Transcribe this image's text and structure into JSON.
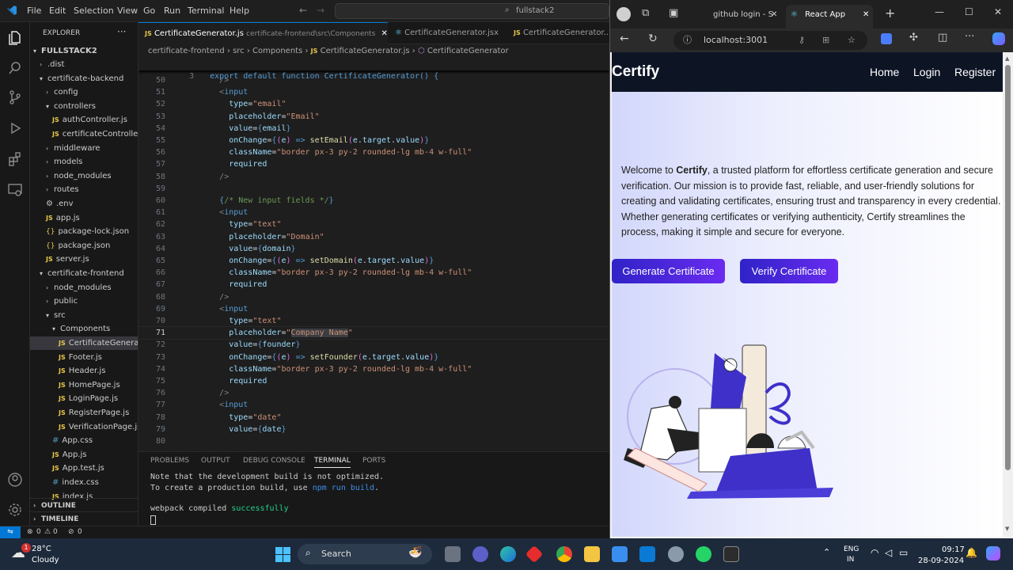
{
  "vscode": {
    "menu": [
      "File",
      "Edit",
      "Selection",
      "View",
      "Go",
      "Run",
      "Terminal",
      "Help"
    ],
    "search": "fullstack2",
    "explorer_title": "EXPLORER",
    "root": "FULLSTACK2",
    "tree": [
      {
        "label": ".dist",
        "type": "folder",
        "indent": 1,
        "open": false
      },
      {
        "label": "certificate-backend",
        "type": "folder",
        "indent": 1,
        "open": true
      },
      {
        "label": "config",
        "type": "folder",
        "indent": 2,
        "open": false
      },
      {
        "label": "controllers",
        "type": "folder",
        "indent": 2,
        "open": true
      },
      {
        "label": "authController.js",
        "type": "js",
        "indent": 3
      },
      {
        "label": "certificateControlle...",
        "type": "js",
        "indent": 3
      },
      {
        "label": "middleware",
        "type": "folder",
        "indent": 2,
        "open": false
      },
      {
        "label": "models",
        "type": "folder",
        "indent": 2,
        "open": false
      },
      {
        "label": "node_modules",
        "type": "folder",
        "indent": 2,
        "open": false
      },
      {
        "label": "routes",
        "type": "folder",
        "indent": 2,
        "open": false
      },
      {
        "label": ".env",
        "type": "env",
        "indent": 2
      },
      {
        "label": "app.js",
        "type": "js",
        "indent": 2
      },
      {
        "label": "package-lock.json",
        "type": "json",
        "indent": 2
      },
      {
        "label": "package.json",
        "type": "json",
        "indent": 2
      },
      {
        "label": "server.js",
        "type": "js",
        "indent": 2
      },
      {
        "label": "certificate-frontend",
        "type": "folder",
        "indent": 1,
        "open": true
      },
      {
        "label": "node_modules",
        "type": "folder",
        "indent": 2,
        "open": false
      },
      {
        "label": "public",
        "type": "folder",
        "indent": 2,
        "open": false
      },
      {
        "label": "src",
        "type": "folder",
        "indent": 2,
        "open": true
      },
      {
        "label": "Components",
        "type": "folder",
        "indent": 3,
        "open": true
      },
      {
        "label": "CertificateGenera...",
        "type": "js",
        "indent": 4,
        "selected": true
      },
      {
        "label": "Footer.js",
        "type": "js",
        "indent": 4
      },
      {
        "label": "Header.js",
        "type": "js",
        "indent": 4
      },
      {
        "label": "HomePage.js",
        "type": "js",
        "indent": 4
      },
      {
        "label": "LoginPage.js",
        "type": "js",
        "indent": 4
      },
      {
        "label": "RegisterPage.js",
        "type": "js",
        "indent": 4
      },
      {
        "label": "VerificationPage.js",
        "type": "js",
        "indent": 4
      },
      {
        "label": "App.css",
        "type": "css",
        "indent": 3
      },
      {
        "label": "App.js",
        "type": "js",
        "indent": 3
      },
      {
        "label": "App.test.js",
        "type": "js",
        "indent": 3
      },
      {
        "label": "index.css",
        "type": "css",
        "indent": 3
      },
      {
        "label": "index.js",
        "type": "js",
        "indent": 3
      }
    ],
    "outline": "OUTLINE",
    "timeline": "TIMELINE",
    "tabs": [
      {
        "label": "CertificateGenerator.js",
        "path": "certificate-frontend\\src\\Components",
        "active": true
      },
      {
        "label": "CertificateGenerator.jsx",
        "path": "",
        "active": false
      },
      {
        "label": "CertificateGenerator...",
        "path": "",
        "active": false
      }
    ],
    "breadcrumb": [
      "certificate-frontend",
      "src",
      "Components",
      "CertificateGenerator.js",
      "CertificateGenerator"
    ],
    "sticky_line": {
      "num": "3",
      "text": "export default function CertificateGenerator() {"
    },
    "code": [
      {
        "n": "50",
        "html": "        <span class='t-tag'>/></span>"
      },
      {
        "n": "51",
        "html": "        <span class='t-tag'>&lt;</span><span class='t-kw'>input</span>"
      },
      {
        "n": "52",
        "html": "          <span class='t-at'>type</span><span class='t-tx'>=</span><span class='t-st'>\"email\"</span>"
      },
      {
        "n": "53",
        "html": "          <span class='t-at'>placeholder</span><span class='t-tx'>=</span><span class='t-st'>\"Email\"</span>"
      },
      {
        "n": "54",
        "html": "          <span class='t-at'>value</span><span class='t-tx'>=</span><span class='t-kw'>{</span><span class='t-at'>email</span><span class='t-kw'>}</span>"
      },
      {
        "n": "55",
        "html": "          <span class='t-at'>onChange</span><span class='t-tx'>=</span><span class='t-kw'>{</span><span class='t-br'>(</span><span class='t-at'>e</span><span class='t-br'>)</span> <span class='t-kw'>=></span> <span class='t-fn'>setEmail</span><span class='t-br'>(</span><span class='t-at'>e</span>.<span class='t-at'>target</span>.<span class='t-at'>value</span><span class='t-br'>)</span><span class='t-kw'>}</span>"
      },
      {
        "n": "56",
        "html": "          <span class='t-at'>className</span><span class='t-tx'>=</span><span class='t-st'>\"border px-3 py-2 rounded-lg mb-4 w-full\"</span>"
      },
      {
        "n": "57",
        "html": "          <span class='t-at'>required</span>"
      },
      {
        "n": "58",
        "html": "        <span class='t-tag'>/></span>"
      },
      {
        "n": "59",
        "html": ""
      },
      {
        "n": "60",
        "html": "        <span class='t-kw'>{</span><span class='t-cm'>/* New input fields */</span><span class='t-kw'>}</span>"
      },
      {
        "n": "61",
        "html": "        <span class='t-tag'>&lt;</span><span class='t-kw'>input</span>"
      },
      {
        "n": "62",
        "html": "          <span class='t-at'>type</span><span class='t-tx'>=</span><span class='t-st'>\"text\"</span>"
      },
      {
        "n": "63",
        "html": "          <span class='t-at'>placeholder</span><span class='t-tx'>=</span><span class='t-st'>\"Domain\"</span>"
      },
      {
        "n": "64",
        "html": "          <span class='t-at'>value</span><span class='t-tx'>=</span><span class='t-kw'>{</span><span class='t-at'>domain</span><span class='t-kw'>}</span>"
      },
      {
        "n": "65",
        "html": "          <span class='t-at'>onChange</span><span class='t-tx'>=</span><span class='t-kw'>{</span><span class='t-br'>(</span><span class='t-at'>e</span><span class='t-br'>)</span> <span class='t-kw'>=></span> <span class='t-fn'>setDomain</span><span class='t-br'>(</span><span class='t-at'>e</span>.<span class='t-at'>target</span>.<span class='t-at'>value</span><span class='t-br'>)</span><span class='t-kw'>}</span>"
      },
      {
        "n": "66",
        "html": "          <span class='t-at'>className</span><span class='t-tx'>=</span><span class='t-st'>\"border px-3 py-2 rounded-lg mb-4 w-full\"</span>"
      },
      {
        "n": "67",
        "html": "          <span class='t-at'>required</span>"
      },
      {
        "n": "68",
        "html": "        <span class='t-tag'>/></span>"
      },
      {
        "n": "69",
        "html": "        <span class='t-tag'>&lt;</span><span class='t-kw'>input</span>"
      },
      {
        "n": "70",
        "html": "          <span class='t-at'>type</span><span class='t-tx'>=</span><span class='t-st'>\"text\"</span>"
      },
      {
        "n": "71",
        "html": "          <span class='t-at'>placeholder</span><span class='t-tx'>=</span><span class='t-st'>\"<span style='background:#3a3d41'>Company Name</span>\"</span>",
        "current": true
      },
      {
        "n": "72",
        "html": "          <span class='t-at'>value</span><span class='t-tx'>=</span><span class='t-kw'>{</span><span class='t-at'>founder</span><span class='t-kw'>}</span>"
      },
      {
        "n": "73",
        "html": "          <span class='t-at'>onChange</span><span class='t-tx'>=</span><span class='t-kw'>{</span><span class='t-br'>(</span><span class='t-at'>e</span><span class='t-br'>)</span> <span class='t-kw'>=></span> <span class='t-fn'>setFounder</span><span class='t-br'>(</span><span class='t-at'>e</span>.<span class='t-at'>target</span>.<span class='t-at'>value</span><span class='t-br'>)</span><span class='t-kw'>}</span>"
      },
      {
        "n": "74",
        "html": "          <span class='t-at'>className</span><span class='t-tx'>=</span><span class='t-st'>\"border px-3 py-2 rounded-lg mb-4 w-full\"</span>"
      },
      {
        "n": "75",
        "html": "          <span class='t-at'>required</span>"
      },
      {
        "n": "76",
        "html": "        <span class='t-tag'>/></span>"
      },
      {
        "n": "77",
        "html": "        <span class='t-tag'>&lt;</span><span class='t-kw'>input</span>"
      },
      {
        "n": "78",
        "html": "          <span class='t-at'>type</span><span class='t-tx'>=</span><span class='t-st'>\"date\"</span>"
      },
      {
        "n": "79",
        "html": "          <span class='t-at'>value</span><span class='t-tx'>=</span><span class='t-kw'>{</span><span class='t-at'>date</span><span class='t-kw'>}</span>"
      },
      {
        "n": "80",
        "html": ""
      }
    ],
    "panel_tabs": [
      "PROBLEMS",
      "OUTPUT",
      "DEBUG CONSOLE",
      "TERMINAL",
      "PORTS"
    ],
    "terminal": {
      "line1": "Note that the development build is not optimized.",
      "line2_a": "To create a production build, use ",
      "line2_b": "npm run build",
      "line2_c": ".",
      "line3_a": "webpack compiled ",
      "line3_b": "successfully"
    },
    "status": {
      "errors": "0",
      "warnings": "0",
      "ports": "0"
    }
  },
  "browser": {
    "tabs": [
      {
        "label": "github login - S",
        "active": false
      },
      {
        "label": "React App",
        "active": true
      }
    ],
    "url": "localhost:3001",
    "site": {
      "brand": "Certify",
      "nav": [
        "Home",
        "Login",
        "Register"
      ],
      "welcome_a": "Welcome to ",
      "welcome_b": "Certify",
      "welcome_c": ", a trusted platform for effortless certificate generation and secure verification. Our mission is to provide fast, reliable, and user-friendly solutions for creating and validating certificates, ensuring trust and transparency in every credential. Whether generating certificates or verifying authenticity, Certify streamlines the process, making it simple and secure for everyone.",
      "btn_generate": "Generate Certificate",
      "btn_verify": "Verify Certificate"
    }
  },
  "taskbar": {
    "weather_temp": "28°C",
    "weather_desc": "Cloudy",
    "search": "Search",
    "lang1": "ENG",
    "lang2": "IN",
    "time": "09:17",
    "date": "28-09-2024",
    "badge": "1"
  },
  "colors": {
    "accent_vscode": "#0078d4",
    "button_gradient_start": "#2f23c7",
    "button_gradient_end": "#6a2bf0",
    "site_nav": "#0d1525"
  }
}
